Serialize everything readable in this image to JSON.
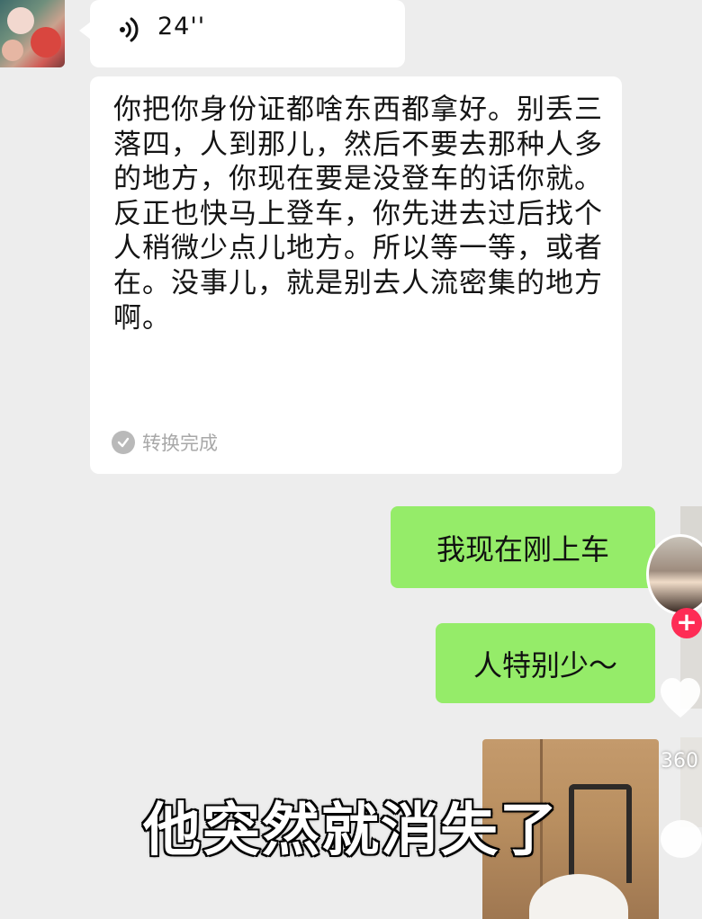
{
  "conversation": {
    "voice_message": {
      "duration": "24''"
    },
    "transcript": {
      "text": "你把你身份证都啥东西都拿好。别丢三落四，人到那儿，然后不要去那种人多的地方，你现在要是没登车的话你就。反正也快马上登车，你先进去过后找个人稍微少点儿地方。所以等一等，或者在。没事儿，就是别去人流密集的地方啊。",
      "status": "转换完成"
    },
    "outgoing": [
      {
        "text": "我现在刚上车"
      },
      {
        "text": "人特别少～"
      }
    ]
  },
  "overlay": {
    "subtitle": "他突然就消失了",
    "like_count": "360",
    "follow_symbol": "+"
  },
  "colors": {
    "background": "#ededed",
    "incoming_bubble": "#ffffff",
    "outgoing_bubble": "#95ec69",
    "follow_button": "#fe2c55"
  },
  "icons": [
    "voice-wave-icon",
    "check-circle-icon",
    "heart-icon",
    "plus-icon",
    "comment-icon"
  ]
}
